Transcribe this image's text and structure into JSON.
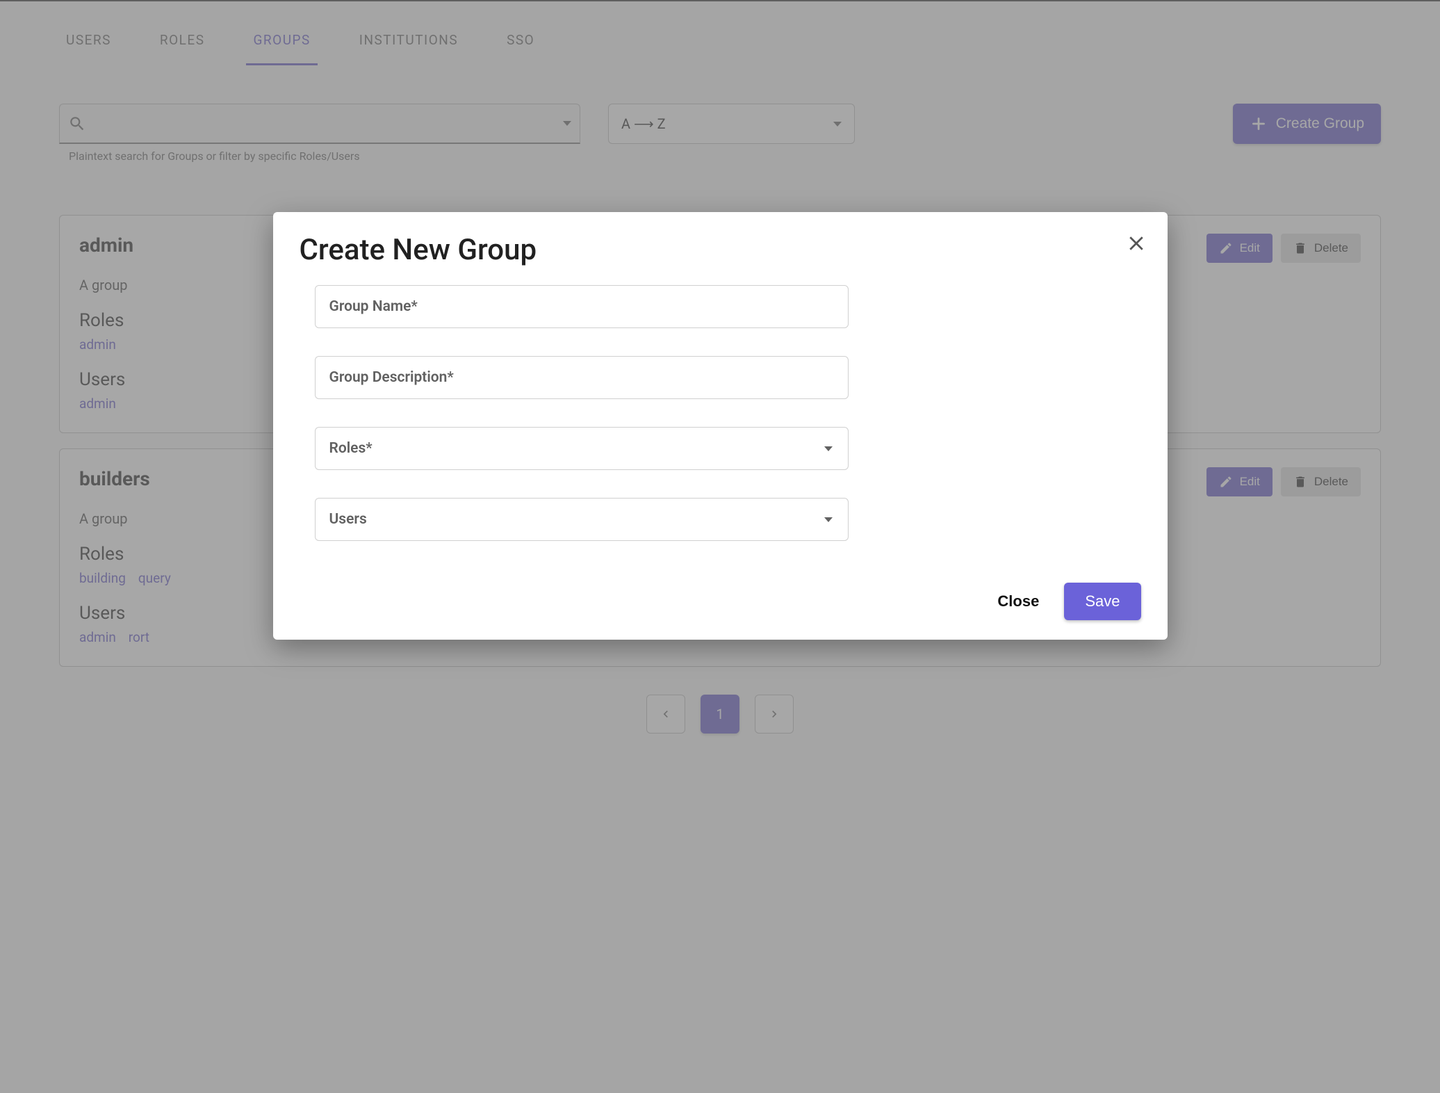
{
  "tabs": {
    "users": "USERS",
    "roles": "ROLES",
    "groups": "GROUPS",
    "institutions": "INSTITUTIONS",
    "sso": "SSO"
  },
  "toolbar": {
    "search_help": "Plaintext search for Groups or filter by specific Roles/Users",
    "sort_label": "A ⟶ Z",
    "create_label": "Create Group"
  },
  "groups": [
    {
      "name": "admin",
      "desc": "A group",
      "roles_label": "Roles",
      "roles": [
        "admin"
      ],
      "users_label": "Users",
      "users": [
        "admin"
      ],
      "edit_label": "Edit",
      "delete_label": "Delete"
    },
    {
      "name": "builders",
      "desc": "A group",
      "roles_label": "Roles",
      "roles": [
        "building",
        "query"
      ],
      "users_label": "Users",
      "users": [
        "admin",
        "rort"
      ],
      "edit_label": "Edit",
      "delete_label": "Delete"
    }
  ],
  "pagination": {
    "current": "1"
  },
  "modal": {
    "title": "Create New Group",
    "fields": {
      "name": "Group Name*",
      "desc": "Group Description*",
      "roles": "Roles*",
      "users": "Users"
    },
    "close_label": "Close",
    "save_label": "Save"
  }
}
